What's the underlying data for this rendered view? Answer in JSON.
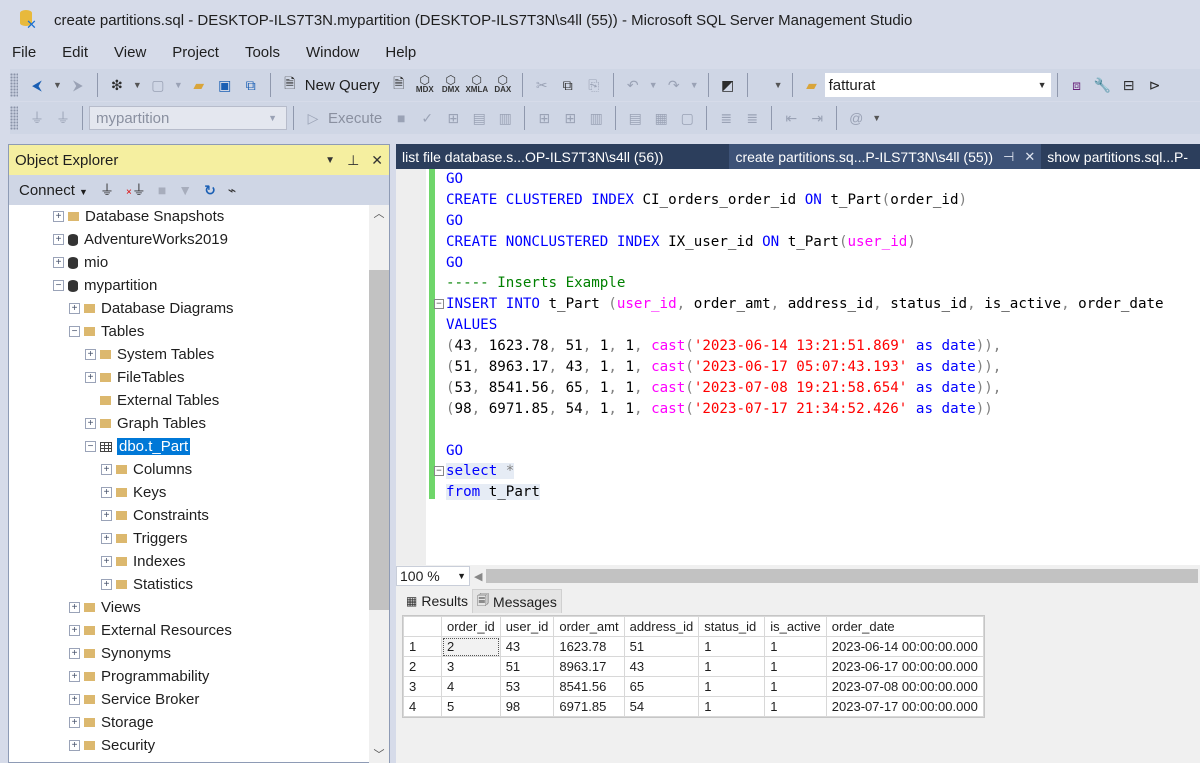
{
  "window": {
    "title": "create partitions.sql - DESKTOP-ILS7T3N.mypartition (DESKTOP-ILS7T3N\\s4ll (55)) - Microsoft SQL Server Management Studio"
  },
  "menu": [
    "File",
    "Edit",
    "View",
    "Project",
    "Tools",
    "Window",
    "Help"
  ],
  "toolbar": {
    "new_query_label": "New Query",
    "mdx": "MDX",
    "dmx": "DMX",
    "xmla": "XMLA",
    "dax": "DAX",
    "search_value": "fatturat",
    "database_selected": "mypartition",
    "execute_label": "Execute"
  },
  "object_explorer": {
    "title": "Object Explorer",
    "connect_label": "Connect",
    "tree": [
      {
        "label": "Database Snapshots",
        "icon": "folder",
        "level": 0,
        "expander": "+"
      },
      {
        "label": "AdventureWorks2019",
        "icon": "database",
        "level": 0,
        "expander": "+"
      },
      {
        "label": "mio",
        "icon": "database",
        "level": 0,
        "expander": "+"
      },
      {
        "label": "mypartition",
        "icon": "database",
        "level": 0,
        "expander": "-"
      },
      {
        "label": "Database Diagrams",
        "icon": "folder",
        "level": 1,
        "expander": "+"
      },
      {
        "label": "Tables",
        "icon": "folder",
        "level": 1,
        "expander": "-"
      },
      {
        "label": "System Tables",
        "icon": "folder",
        "level": 2,
        "expander": "+"
      },
      {
        "label": "FileTables",
        "icon": "folder",
        "level": 2,
        "expander": "+"
      },
      {
        "label": "External Tables",
        "icon": "folder",
        "level": 2,
        "expander": ""
      },
      {
        "label": "Graph Tables",
        "icon": "folder",
        "level": 2,
        "expander": "+"
      },
      {
        "label": "dbo.t_Part",
        "icon": "table",
        "level": 2,
        "expander": "-",
        "selected": true
      },
      {
        "label": "Columns",
        "icon": "folder",
        "level": 3,
        "expander": "+"
      },
      {
        "label": "Keys",
        "icon": "folder",
        "level": 3,
        "expander": "+"
      },
      {
        "label": "Constraints",
        "icon": "folder",
        "level": 3,
        "expander": "+"
      },
      {
        "label": "Triggers",
        "icon": "folder",
        "level": 3,
        "expander": "+"
      },
      {
        "label": "Indexes",
        "icon": "folder",
        "level": 3,
        "expander": "+"
      },
      {
        "label": "Statistics",
        "icon": "folder",
        "level": 3,
        "expander": "+"
      },
      {
        "label": "Views",
        "icon": "folder",
        "level": 1,
        "expander": "+"
      },
      {
        "label": "External Resources",
        "icon": "folder",
        "level": 1,
        "expander": "+"
      },
      {
        "label": "Synonyms",
        "icon": "folder",
        "level": 1,
        "expander": "+"
      },
      {
        "label": "Programmability",
        "icon": "folder",
        "level": 1,
        "expander": "+"
      },
      {
        "label": "Service Broker",
        "icon": "folder",
        "level": 1,
        "expander": "+"
      },
      {
        "label": "Storage",
        "icon": "folder",
        "level": 1,
        "expander": "+"
      },
      {
        "label": "Security",
        "icon": "folder",
        "level": 1,
        "expander": "+"
      }
    ]
  },
  "tabs": [
    {
      "label": "list file database.s...OP-ILS7T3N\\s4ll (56))",
      "active": false
    },
    {
      "label": "create partitions.sq...P-ILS7T3N\\s4ll (55))",
      "active": true
    },
    {
      "label": "show partitions.sql...P-",
      "active": false
    }
  ],
  "editor": {
    "lines": [
      [
        [
          "kw",
          "GO"
        ]
      ],
      [
        [
          "kw",
          "CREATE CLUSTERED INDEX "
        ],
        [
          "id",
          "CI_orders_order_id "
        ],
        [
          "kw",
          "ON "
        ],
        [
          "id",
          "t_Part"
        ],
        [
          "pn",
          "("
        ],
        [
          "id",
          "order_id"
        ],
        [
          "pn",
          ")"
        ]
      ],
      [
        [
          "kw",
          "GO"
        ]
      ],
      [
        [
          "kw",
          "CREATE NONCLUSTERED INDEX "
        ],
        [
          "id",
          "IX_user_id "
        ],
        [
          "kw",
          "ON "
        ],
        [
          "id",
          "t_Part"
        ],
        [
          "pn",
          "("
        ],
        [
          "fn",
          "user_id"
        ],
        [
          "pn",
          ")"
        ]
      ],
      [
        [
          "kw",
          "GO"
        ]
      ],
      [
        [
          "cm",
          "----- Inserts Example"
        ]
      ],
      [
        [
          "kw",
          "INSERT INTO "
        ],
        [
          "id",
          "t_Part "
        ],
        [
          "pn",
          "("
        ],
        [
          "fn",
          "user_id"
        ],
        [
          "pn",
          ", "
        ],
        [
          "id",
          "order_amt"
        ],
        [
          "pn",
          ", "
        ],
        [
          "id",
          "address_id"
        ],
        [
          "pn",
          ", "
        ],
        [
          "id",
          "status_id"
        ],
        [
          "pn",
          ", "
        ],
        [
          "id",
          "is_active"
        ],
        [
          "pn",
          ", "
        ],
        [
          "id",
          "order_date"
        ]
      ],
      [
        [
          "kw",
          "VALUES"
        ]
      ],
      [
        [
          "pn",
          "("
        ],
        [
          "id",
          "43"
        ],
        [
          "pn",
          ", "
        ],
        [
          "id",
          "1623.78"
        ],
        [
          "pn",
          ", "
        ],
        [
          "id",
          "51"
        ],
        [
          "pn",
          ", "
        ],
        [
          "id",
          "1"
        ],
        [
          "pn",
          ", "
        ],
        [
          "id",
          "1"
        ],
        [
          "pn",
          ", "
        ],
        [
          "fn",
          "cast"
        ],
        [
          "pn",
          "("
        ],
        [
          "str",
          "'2023-06-14 13:21:51.869'"
        ],
        [
          "kw",
          " as date"
        ],
        [
          "pn",
          "))"
        ],
        [
          "pn",
          ","
        ]
      ],
      [
        [
          "pn",
          "("
        ],
        [
          "id",
          "51"
        ],
        [
          "pn",
          ", "
        ],
        [
          "id",
          "8963.17"
        ],
        [
          "pn",
          ", "
        ],
        [
          "id",
          "43"
        ],
        [
          "pn",
          ", "
        ],
        [
          "id",
          "1"
        ],
        [
          "pn",
          ", "
        ],
        [
          "id",
          "1"
        ],
        [
          "pn",
          ", "
        ],
        [
          "fn",
          "cast"
        ],
        [
          "pn",
          "("
        ],
        [
          "str",
          "'2023-06-17 05:07:43.193'"
        ],
        [
          "kw",
          " as date"
        ],
        [
          "pn",
          "))"
        ],
        [
          "pn",
          ","
        ]
      ],
      [
        [
          "pn",
          "("
        ],
        [
          "id",
          "53"
        ],
        [
          "pn",
          ", "
        ],
        [
          "id",
          "8541.56"
        ],
        [
          "pn",
          ", "
        ],
        [
          "id",
          "65"
        ],
        [
          "pn",
          ", "
        ],
        [
          "id",
          "1"
        ],
        [
          "pn",
          ", "
        ],
        [
          "id",
          "1"
        ],
        [
          "pn",
          ", "
        ],
        [
          "fn",
          "cast"
        ],
        [
          "pn",
          "("
        ],
        [
          "str",
          "'2023-07-08 19:21:58.654'"
        ],
        [
          "kw",
          " as date"
        ],
        [
          "pn",
          "))"
        ],
        [
          "pn",
          ","
        ]
      ],
      [
        [
          "pn",
          "("
        ],
        [
          "id",
          "98"
        ],
        [
          "pn",
          ", "
        ],
        [
          "id",
          "6971.85"
        ],
        [
          "pn",
          ", "
        ],
        [
          "id",
          "54"
        ],
        [
          "pn",
          ", "
        ],
        [
          "id",
          "1"
        ],
        [
          "pn",
          ", "
        ],
        [
          "id",
          "1"
        ],
        [
          "pn",
          ", "
        ],
        [
          "fn",
          "cast"
        ],
        [
          "pn",
          "("
        ],
        [
          "str",
          "'2023-07-17 21:34:52.426'"
        ],
        [
          "kw",
          " as date"
        ],
        [
          "pn",
          "))"
        ]
      ],
      [],
      [
        [
          "kw",
          "GO"
        ]
      ],
      [
        [
          "kw",
          "select "
        ],
        [
          "pn",
          "*"
        ]
      ],
      [
        [
          "kw",
          "from "
        ],
        [
          "id",
          "t_Part"
        ]
      ]
    ]
  },
  "zoom_level": "100 %",
  "results": {
    "tabs": [
      "Results",
      "Messages"
    ],
    "columns": [
      "order_id",
      "user_id",
      "order_amt",
      "address_id",
      "status_id",
      "is_active",
      "order_date"
    ],
    "rows": [
      [
        "1",
        "2",
        "43",
        "1623.78",
        "51",
        "1",
        "1",
        "2023-06-14 00:00:00.000"
      ],
      [
        "2",
        "3",
        "51",
        "8963.17",
        "43",
        "1",
        "1",
        "2023-06-17 00:00:00.000"
      ],
      [
        "3",
        "4",
        "53",
        "8541.56",
        "65",
        "1",
        "1",
        "2023-07-08 00:00:00.000"
      ],
      [
        "4",
        "5",
        "98",
        "6971.85",
        "54",
        "1",
        "1",
        "2023-07-17 00:00:00.000"
      ]
    ]
  }
}
